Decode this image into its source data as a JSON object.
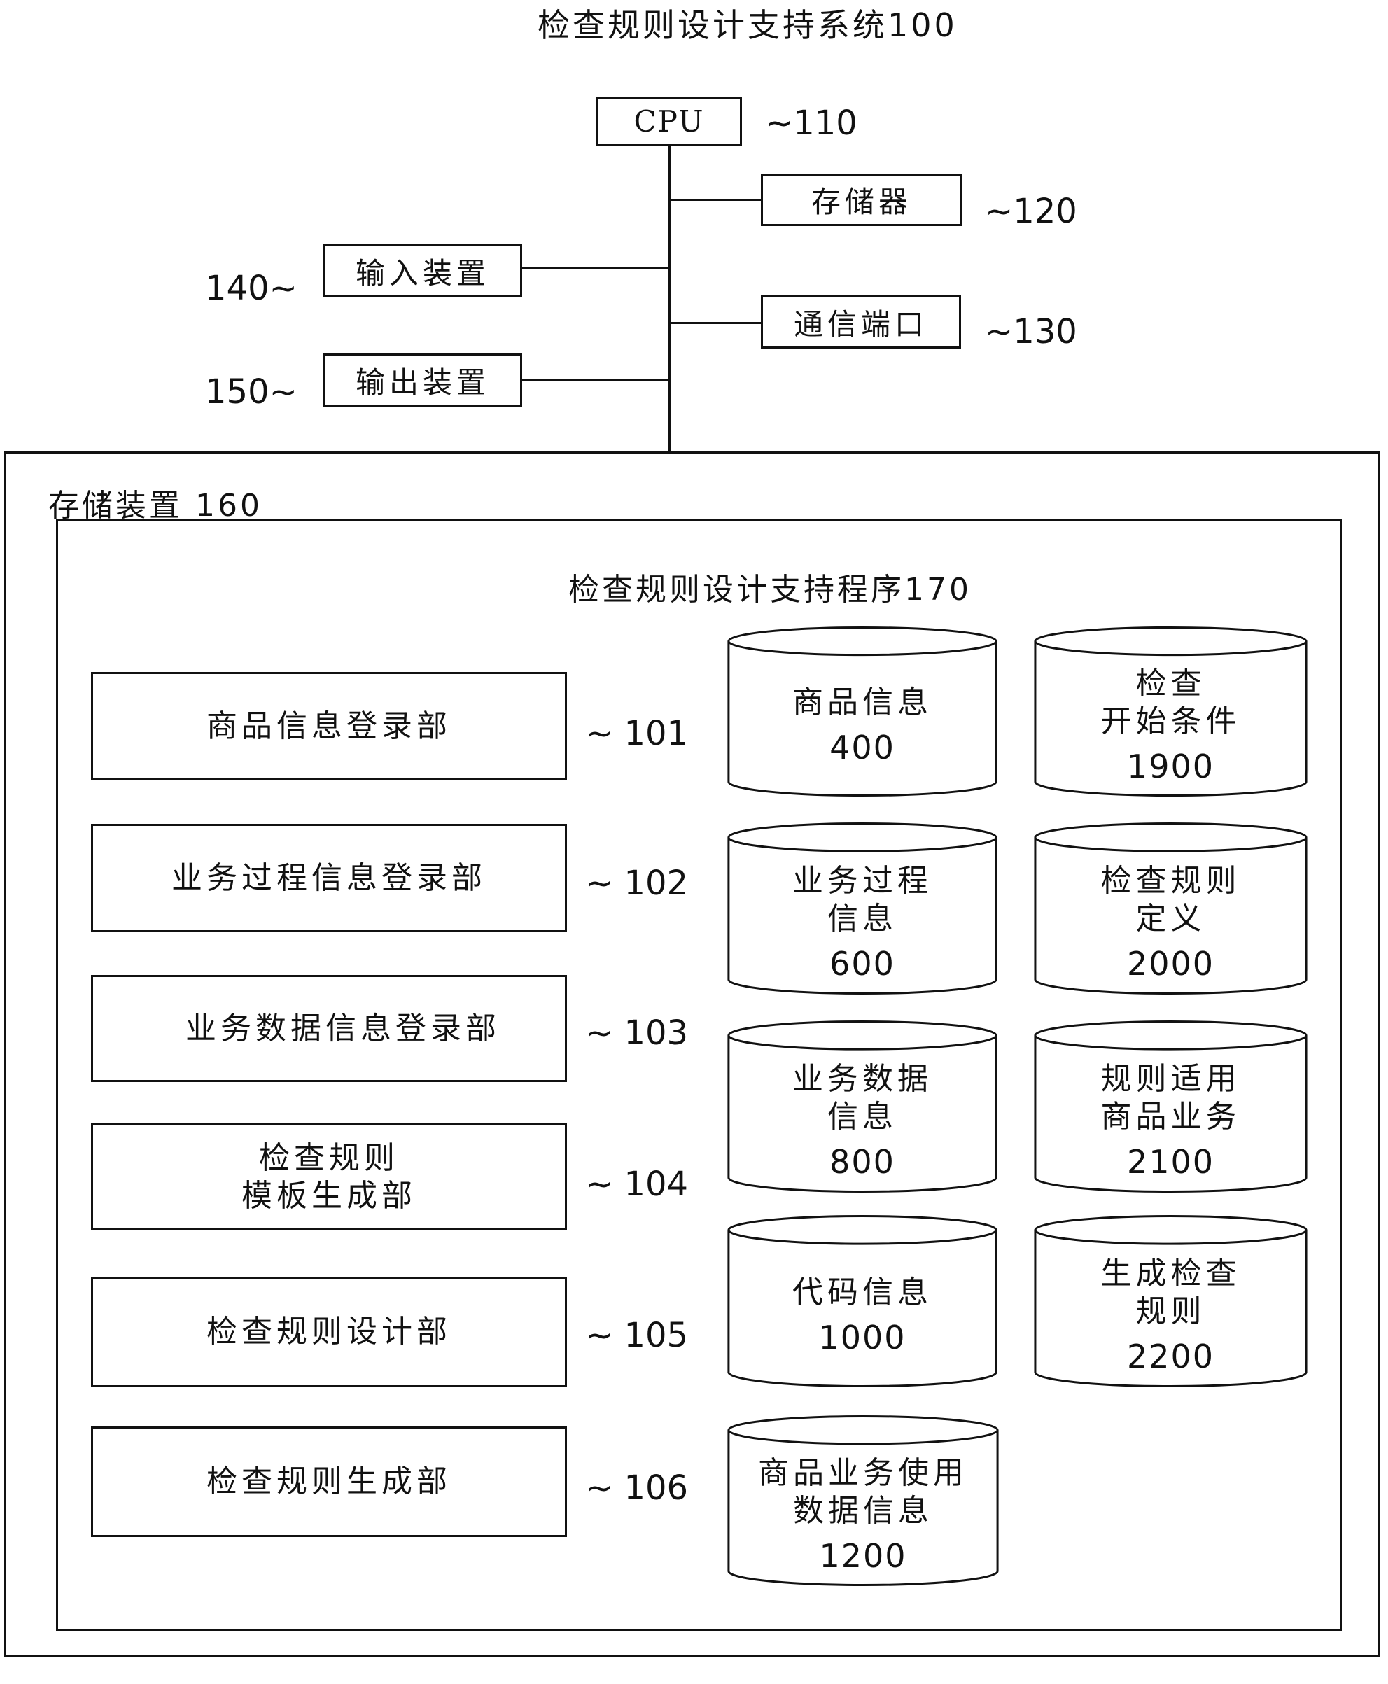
{
  "system": {
    "title": "检查规则设计支持系统100"
  },
  "hardware": {
    "cpu": {
      "label": "CPU",
      "ref": "~110"
    },
    "memory": {
      "label": "存储器",
      "ref": "~120"
    },
    "comm_port": {
      "label": "通信端口",
      "ref": "~130"
    },
    "input_device": {
      "label": "输入装置",
      "ref": "140~"
    },
    "output_device": {
      "label": "输出装置",
      "ref": "150~"
    }
  },
  "storage": {
    "label": "存储装置 160",
    "program": {
      "title": "检查规则设计支持程序170",
      "modules": [
        {
          "label": "商品信息登录部",
          "ref": "~ 101"
        },
        {
          "label": "业务过程信息登录部",
          "ref": "~ 102"
        },
        {
          "label": "业务数据信息登录部",
          "ref": "~ 103"
        },
        {
          "label_line1": "检查规则",
          "label_line2": "模板生成部",
          "ref": "~ 104"
        },
        {
          "label": "检查规则设计部",
          "ref": "~ 105"
        },
        {
          "label": "检查规则生成部",
          "ref": "~ 106"
        }
      ],
      "databases": [
        {
          "lines": [
            "商品信息"
          ],
          "number": "400"
        },
        {
          "lines": [
            "检查",
            "开始条件"
          ],
          "number": "1900"
        },
        {
          "lines": [
            "业务过程",
            "信息"
          ],
          "number": "600"
        },
        {
          "lines": [
            "检查规则",
            "定义"
          ],
          "number": "2000"
        },
        {
          "lines": [
            "业务数据",
            "信息"
          ],
          "number": "800"
        },
        {
          "lines": [
            "规则适用",
            "商品业务"
          ],
          "number": "2100"
        },
        {
          "lines": [
            "代码信息"
          ],
          "number": "1000"
        },
        {
          "lines": [
            "生成检查",
            "规则"
          ],
          "number": "2200"
        },
        {
          "lines": [
            "商品业务使用",
            "数据信息"
          ],
          "number": "1200"
        }
      ]
    }
  }
}
